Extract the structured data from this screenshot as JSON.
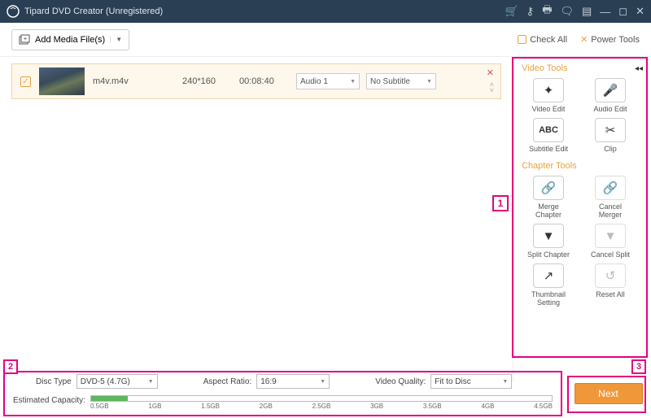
{
  "titlebar": {
    "title": "Tipard DVD Creator (Unregistered)"
  },
  "toolbar": {
    "add_media": "Add Media File(s)",
    "check_all": "Check All",
    "power_tools": "Power Tools"
  },
  "file": {
    "name": "m4v.m4v",
    "resolution": "240*160",
    "duration": "00:08:40",
    "audio": "Audio 1",
    "subtitle": "No Subtitle"
  },
  "video_tools": {
    "title": "Video Tools",
    "items": [
      {
        "label": "Video Edit",
        "icon": "✦"
      },
      {
        "label": "Audio Edit",
        "icon": "🎤"
      },
      {
        "label": "Subtitle Edit",
        "icon": "ABC"
      },
      {
        "label": "Clip",
        "icon": "✂"
      }
    ]
  },
  "chapter_tools": {
    "title": "Chapter Tools",
    "items": [
      {
        "label": "Merge Chapter",
        "icon": "🔗",
        "enabled": true
      },
      {
        "label": "Cancel Merger",
        "icon": "🔗",
        "enabled": false
      },
      {
        "label": "Split Chapter",
        "icon": "▼",
        "enabled": true
      },
      {
        "label": "Cancel Split",
        "icon": "▼",
        "enabled": false
      },
      {
        "label": "Thumbnail Setting",
        "icon": "↗",
        "enabled": true
      },
      {
        "label": "Reset All",
        "icon": "↺",
        "enabled": false
      }
    ]
  },
  "config": {
    "disc_type_label": "Disc Type",
    "disc_type": "DVD-5 (4.7G)",
    "aspect_label": "Aspect Ratio:",
    "aspect": "16:9",
    "quality_label": "Video Quality:",
    "quality": "Fit to Disc",
    "capacity_label": "Estimated Capacity:",
    "ticks": [
      "0.5GB",
      "1GB",
      "1.5GB",
      "2GB",
      "2.5GB",
      "3GB",
      "3.5GB",
      "4GB",
      "4.5GB"
    ],
    "fill_percent": 8
  },
  "next_label": "Next",
  "annotations": {
    "a1": "1",
    "a2": "2",
    "a3": "3"
  }
}
